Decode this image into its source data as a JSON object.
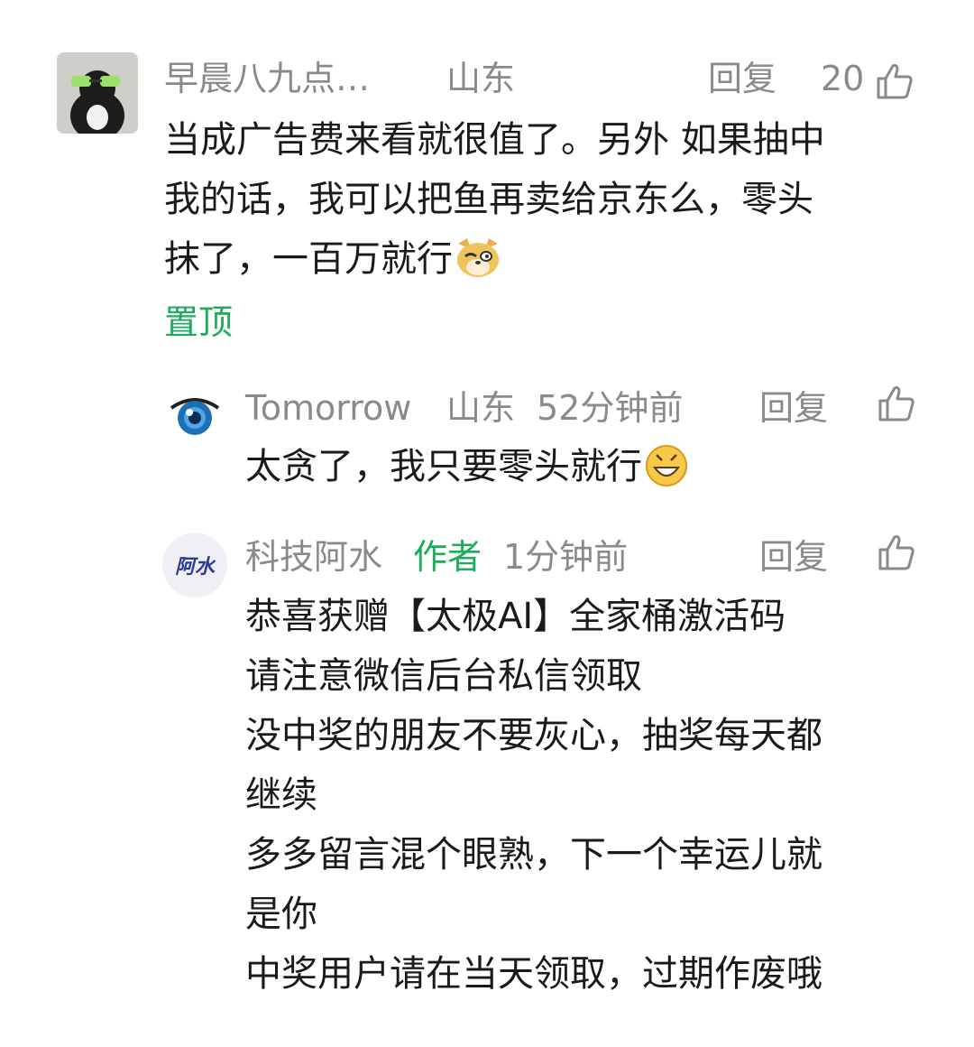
{
  "comments": [
    {
      "author": "早晨八九点…",
      "location": "山东",
      "reply_label": "回复",
      "likes": "20",
      "lines": [
        "当成广告费来看就很值了。另外 如果抽中",
        "我的话，我可以把鱼再卖给京东么，零头",
        "抹了，一百万就行"
      ],
      "pinned_label": "置顶"
    },
    {
      "author": "Tomorrow",
      "location": "山东",
      "time": "52分钟前",
      "reply_label": "回复",
      "text": "太贪了，我只要零头就行"
    },
    {
      "author": "科技阿水",
      "author_badge": "作者",
      "time": "1分钟前",
      "reply_label": "回复",
      "avatar_text": "阿水",
      "lines": [
        "恭喜获赠【太极AI】全家桶激活码",
        "请注意微信后台私信领取",
        "没中奖的朋友不要灰心，抽奖每天都",
        "继续",
        "多多留言混个眼熟，下一个幸运儿就",
        "是你",
        "中奖用户请在当天领取，过期作废哦"
      ]
    }
  ],
  "colors": {
    "meta": "#8a8a8a",
    "text": "#1a1a1a",
    "accent": "#1aad5a"
  },
  "icons": [
    "thumbs-up-icon",
    "doge-emoji",
    "grin-emoji",
    "eye-avatar"
  ]
}
